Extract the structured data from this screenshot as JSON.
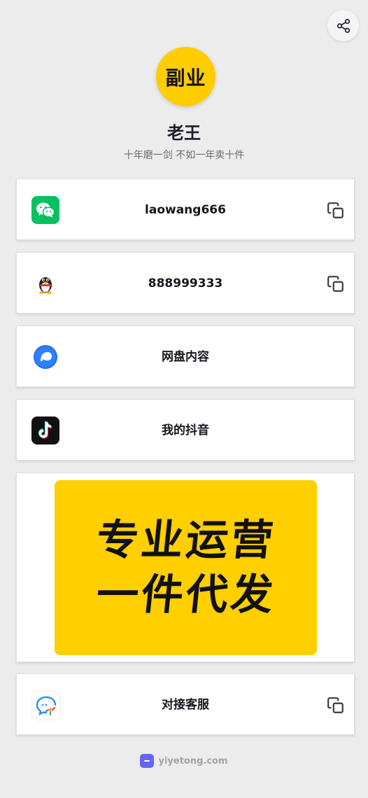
{
  "profile": {
    "avatar_text": "副业",
    "name": "老王",
    "bio": "十年磨一剑 不如一年卖十件"
  },
  "links": [
    {
      "label": "laowang666",
      "icon": "wechat-icon",
      "copyable": true
    },
    {
      "label": "888999333",
      "icon": "qq-penguin-icon",
      "copyable": true
    },
    {
      "label": "网盘内容",
      "icon": "cloud-drive-icon",
      "copyable": false
    },
    {
      "label": "我的抖音",
      "icon": "douyin-icon",
      "copyable": false
    },
    {
      "label": "对接客服",
      "icon": "customer-service-icon",
      "copyable": true
    }
  ],
  "banner": {
    "line1": "专业运营",
    "line2": "一件代发"
  },
  "footer": {
    "text": "yiyetong.com"
  },
  "colors": {
    "accent": "#ffcd00",
    "background": "#ececec",
    "wechat": "#07c160",
    "footer_logo": "#6366f1"
  }
}
